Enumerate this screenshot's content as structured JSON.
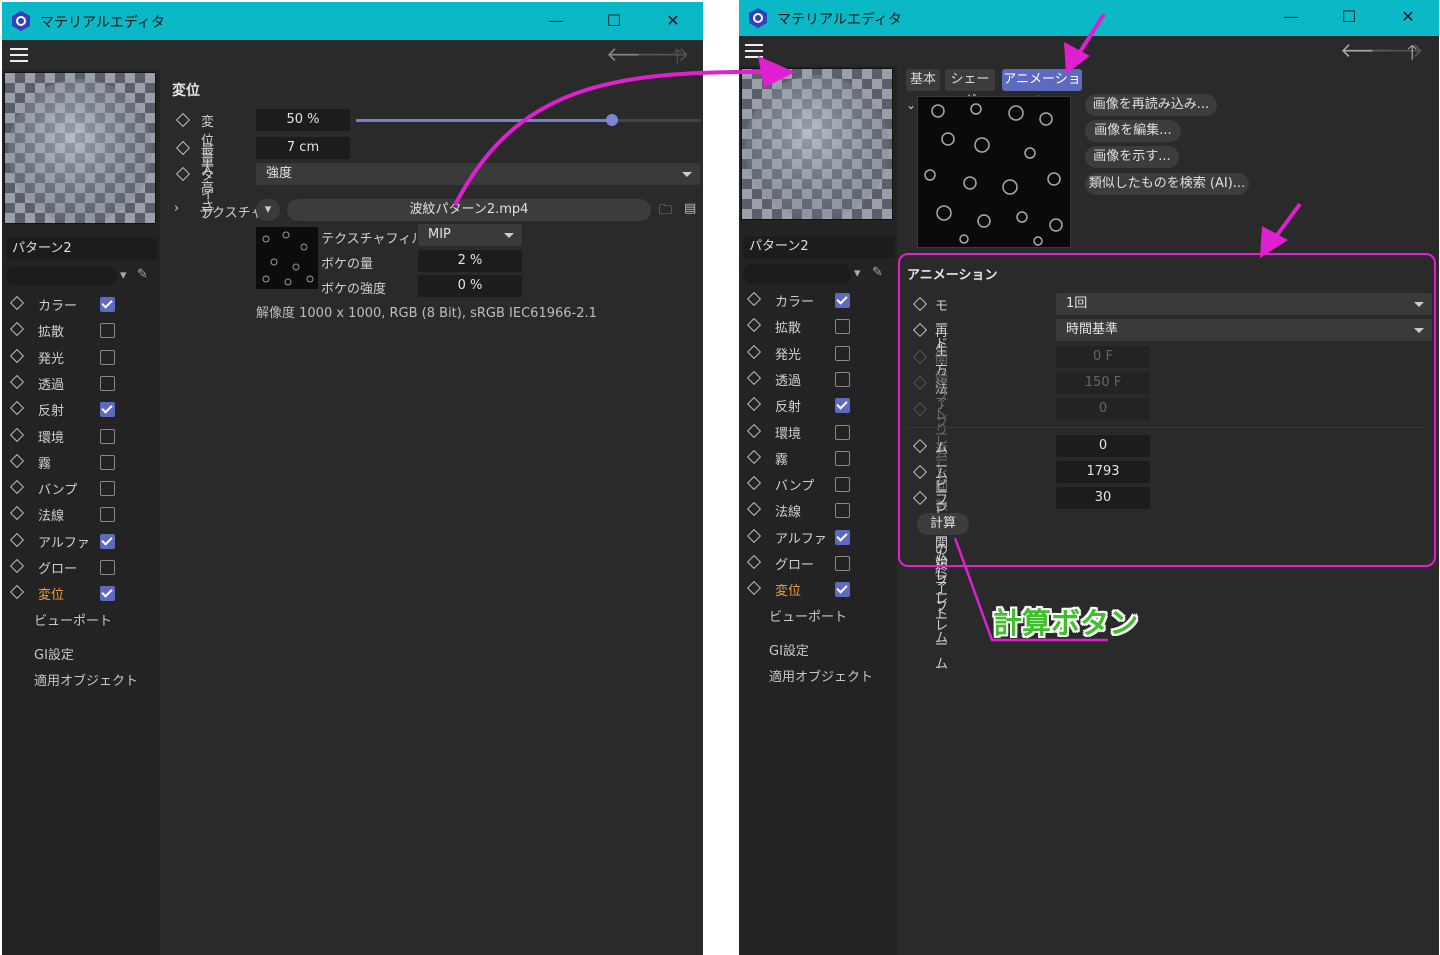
{
  "app_title": "マテリアルエディタ",
  "left": {
    "material_name": "パターン2",
    "section_title": "変位",
    "params": {
      "amount_label": "変位量",
      "amount_value": "50 %",
      "amount_fraction": 0.5,
      "height_label": "最大高さ",
      "height_value": "7 cm",
      "type_label": "タイプ",
      "type_value": "強度",
      "texture_label": "テクスチャ",
      "texture_file": "波紋パターン2.mp4",
      "filter_label": "テクスチャフィルタ",
      "filter_value": "MIP",
      "blur_offset_label": "ボケの量",
      "blur_offset_value": "2 %",
      "blur_scale_label": "ボケの強度",
      "blur_scale_value": "0 %",
      "resolution": "解像度 1000 x 1000, RGB (8 Bit), sRGB IEC61966-2.1"
    }
  },
  "channels": [
    {
      "label": "カラー",
      "checked": true
    },
    {
      "label": "拡散",
      "checked": false
    },
    {
      "label": "発光",
      "checked": false
    },
    {
      "label": "透過",
      "checked": false
    },
    {
      "label": "反射",
      "checked": true
    },
    {
      "label": "環境",
      "checked": false
    },
    {
      "label": "霧",
      "checked": false
    },
    {
      "label": "バンプ",
      "checked": false
    },
    {
      "label": "法線",
      "checked": false
    },
    {
      "label": "アルファ",
      "checked": true
    },
    {
      "label": "グロー",
      "checked": false
    },
    {
      "label": "変位",
      "checked": true,
      "active": true
    }
  ],
  "extra_items": [
    "ビューポート",
    "GI設定",
    "適用オブジェクト"
  ],
  "right": {
    "material_name": "パターン2",
    "tabs": [
      "基本",
      "シェーダ",
      "アニメーション"
    ],
    "active_tab": "アニメーション",
    "image_buttons": [
      "画像を再読み込み...",
      "画像を編集...",
      "画像を示す...",
      "類似したものを検索 (AI)..."
    ],
    "anim_title": "アニメーション",
    "mode_label": "モード",
    "mode_value": "1回",
    "timing_label": "再生方法",
    "timing_value": "時間基準",
    "start_frame_label": "開始フレーム",
    "start_frame_value": "0 F",
    "end_frame_label": "終了フレーム",
    "end_frame_value": "150 F",
    "loops_label": "くり返し回数",
    "loops_value": "0",
    "movie_start_label": "ムービーの開始フレーム",
    "movie_start_value": "0",
    "movie_end_label": "ムービーの終了フレーム",
    "movie_end_value": "1793",
    "fps_label": "フレームレート",
    "fps_value": "30",
    "calc_button": "計算"
  },
  "annotation": {
    "callout_text": "計算ボタン",
    "annotation_color": "#e020d0",
    "callout_color": "#3fbf2a"
  },
  "colors": {
    "titlebar": "#0bb9c6",
    "panel": "#2a2a2a",
    "accent": "#5c6bc0",
    "active_channel": "#f0a040"
  }
}
